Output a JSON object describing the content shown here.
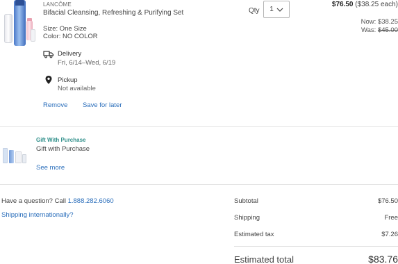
{
  "product": {
    "brand": "LANCÔME",
    "name": "Bifacial Cleansing, Refreshing & Purifying Set",
    "size": "Size: One Size",
    "color": "Color: NO COLOR",
    "delivery_label": "Delivery",
    "delivery_dates": "Fri, 6/14–Wed, 6/19",
    "pickup_label": "Pickup",
    "pickup_status": "Not available",
    "remove_label": "Remove",
    "save_label": "Save for later",
    "qty_label": "Qty",
    "qty_value": "1",
    "price": "$76.50",
    "price_each": "($38.25 each)",
    "now_label": "Now:",
    "now_price": "$38.25",
    "was_label": "Was:",
    "was_price": "$45.00"
  },
  "gift": {
    "badge": "Gift With Purchase",
    "name": "Gift with Purchase",
    "see_more": "See more"
  },
  "help": {
    "question": "Have a question? Call",
    "phone": "1.888.282.6060",
    "shipping_int": "Shipping internationally?"
  },
  "summary": {
    "subtotal_label": "Subtotal",
    "subtotal_value": "$76.50",
    "shipping_label": "Shipping",
    "shipping_value": "Free",
    "tax_label": "Estimated tax",
    "tax_value": "$7.26",
    "total_label": "Estimated total",
    "total_value": "$83.76"
  },
  "colors": {
    "link": "#2a6ebb",
    "gift_badge": "#2f8f8a"
  }
}
